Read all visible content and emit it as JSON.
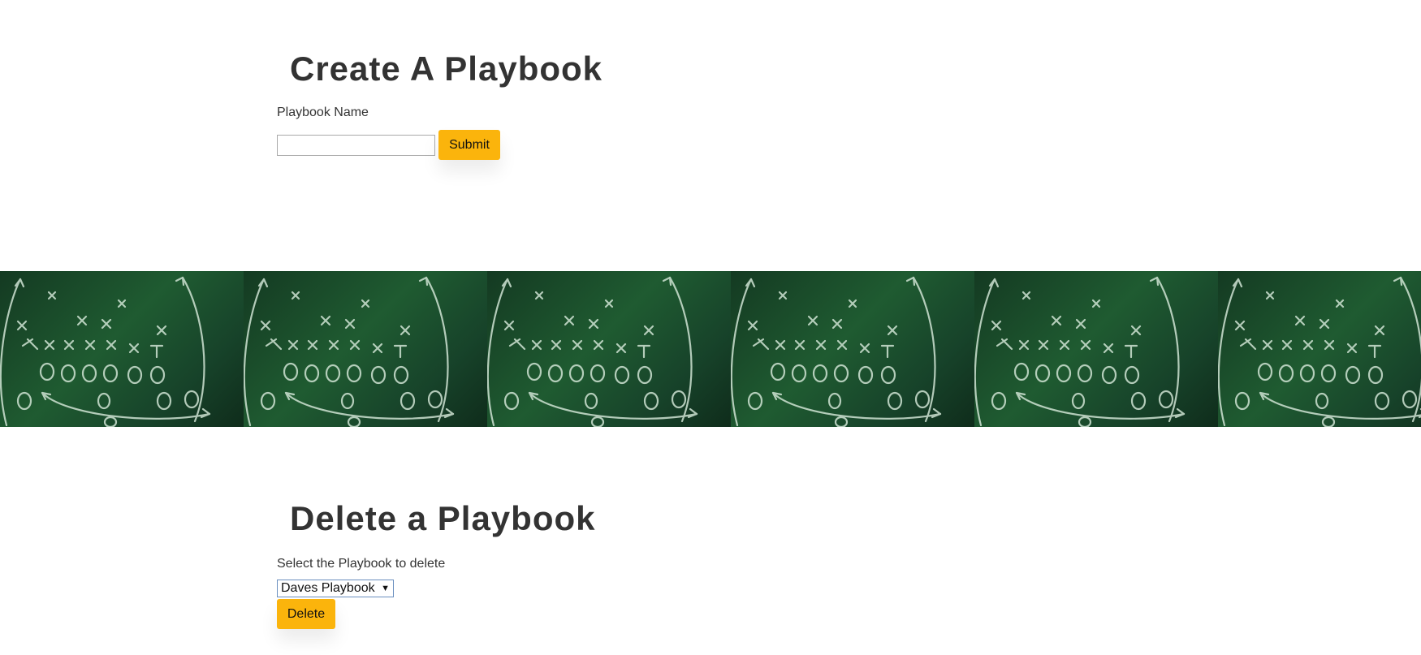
{
  "create": {
    "heading": "Create A Playbook",
    "field_label": "Playbook Name",
    "input_value": "",
    "submit_label": "Submit"
  },
  "banner": {
    "image": "football-play-chalkboard",
    "tile_count": 6,
    "colors": {
      "board": "#1f5b31",
      "chalk": "#cfe3d3"
    }
  },
  "delete": {
    "heading": "Delete a Playbook",
    "field_label": "Select the Playbook to delete",
    "selected_option": "Daves Playbook",
    "delete_label": "Delete"
  },
  "colors": {
    "accent": "#fbb40c",
    "text": "#333333"
  }
}
